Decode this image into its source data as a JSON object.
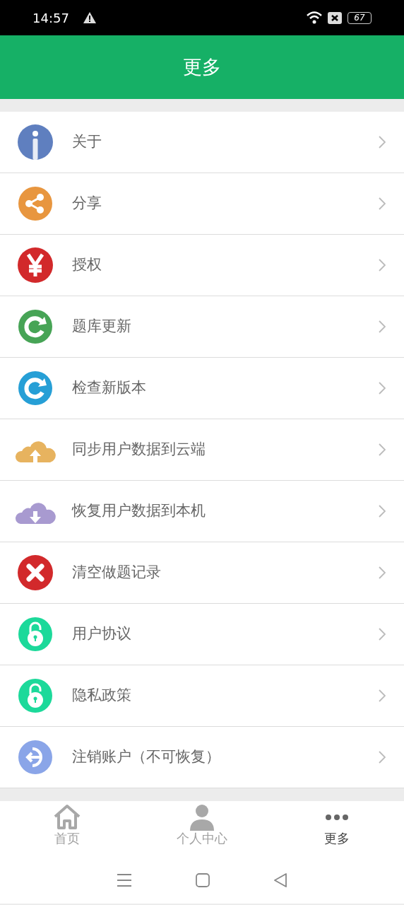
{
  "status_bar": {
    "time": "14:57",
    "battery": "67"
  },
  "header": {
    "title": "更多"
  },
  "menu": [
    {
      "label": "关于",
      "kind": "info",
      "color": "#5f7fbf"
    },
    {
      "label": "分享",
      "kind": "share",
      "color": "#e8963f"
    },
    {
      "label": "授权",
      "kind": "yen",
      "color": "#d2292b"
    },
    {
      "label": "题库更新",
      "kind": "refresh",
      "color": "#47a456"
    },
    {
      "label": "检查新版本",
      "kind": "refresh",
      "color": "#269fd6"
    },
    {
      "label": "同步用户数据到云端",
      "kind": "cloud-up",
      "color": "#e7b35f"
    },
    {
      "label": "恢复用户数据到本机",
      "kind": "cloud-down",
      "color": "#a89ad0"
    },
    {
      "label": "清空做题记录",
      "kind": "close",
      "color": "#d2292b"
    },
    {
      "label": "用户协议",
      "kind": "lock",
      "color": "#1cd99a"
    },
    {
      "label": "隐私政策",
      "kind": "lock",
      "color": "#1cd99a"
    },
    {
      "label": "注销账户（不可恢复）",
      "kind": "logout",
      "color": "#8aa5e8"
    }
  ],
  "tabs": [
    {
      "label": "首页",
      "kind": "home",
      "selected": false
    },
    {
      "label": "个人中心",
      "kind": "person",
      "selected": false
    },
    {
      "label": "更多",
      "kind": "more",
      "selected": true
    }
  ]
}
